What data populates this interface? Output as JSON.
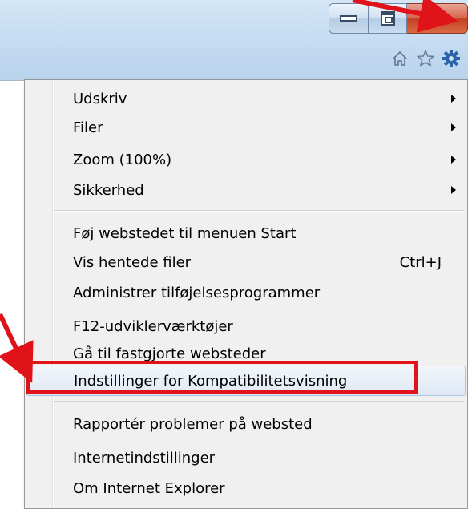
{
  "window": {
    "caption": {
      "minimize_icon": "minimize-icon",
      "maximize_icon": "restore-icon",
      "close_icon": "close-icon",
      "close_glyph": "✕"
    },
    "toolbar": {
      "icons": [
        "home-icon",
        "favorites-star-icon",
        "tools-gear-icon"
      ],
      "accent": "#2a64a8"
    }
  },
  "menu": {
    "items": [
      {
        "label": "Udskriv",
        "submenu": true
      },
      {
        "label": "Filer",
        "submenu": true
      },
      {
        "label": "Zoom (100%)",
        "submenu": true
      },
      {
        "label": "Sikkerhed",
        "submenu": true
      },
      {
        "label": "Føj webstedet til menuen Start",
        "submenu": false
      },
      {
        "label": "Vis hentede filer",
        "shortcut": "Ctrl+J",
        "submenu": false
      },
      {
        "label": "Administrer tilføjelsesprogrammer",
        "submenu": false
      },
      {
        "label": "F12-udviklerværktøjer",
        "submenu": false
      },
      {
        "label": "Gå til fastgjorte websteder",
        "submenu": false
      },
      {
        "label": "Indstillinger for Kompatibilitetsvisning",
        "submenu": false,
        "highlighted": true
      },
      {
        "label": "Rapportér problemer på websted",
        "submenu": false
      },
      {
        "label": "Internetindstillinger",
        "submenu": false
      },
      {
        "label": "Om Internet Explorer",
        "submenu": false
      }
    ]
  },
  "annotation": {
    "highlight_color": "#e0131b"
  }
}
